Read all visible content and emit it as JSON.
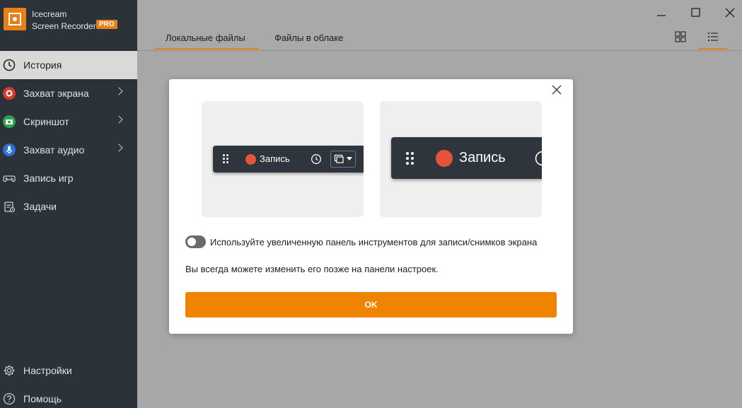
{
  "app": {
    "title_line1": "Icecream",
    "title_line2": "Screen Recorder",
    "badge": "PRO"
  },
  "sidebar": {
    "items": [
      {
        "label": "История",
        "icon": "clock-icon"
      },
      {
        "label": "Захват экрана",
        "icon": "record-icon"
      },
      {
        "label": "Скриншот",
        "icon": "camera-icon"
      },
      {
        "label": "Захват аудио",
        "icon": "microphone-icon"
      },
      {
        "label": "Запись игр",
        "icon": "gamepad-icon"
      },
      {
        "label": "Задачи",
        "icon": "tasks-icon"
      }
    ],
    "bottom": [
      {
        "label": "Настройки",
        "icon": "gear-icon"
      },
      {
        "label": "Помощь",
        "icon": "help-icon"
      }
    ]
  },
  "main": {
    "tabs": [
      {
        "label": "Локальные файлы"
      },
      {
        "label": "Файлы в облаке"
      }
    ]
  },
  "dialog": {
    "preview_small_label": "Запись",
    "preview_large_label": "Запись",
    "toggle_label": "Используйте увеличенную панель инструментов для записи/снимков экрана",
    "hint": "Вы всегда можете изменить его позже на панели настроек.",
    "ok_label": "OK",
    "toggle_on": false
  },
  "colors": {
    "accent": "#f08300",
    "sidebar_bg": "#2c323a",
    "record_red": "#e5533a"
  }
}
